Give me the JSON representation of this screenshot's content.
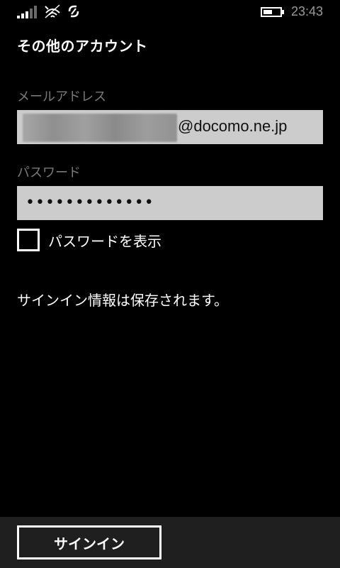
{
  "status_bar": {
    "time": "23:43",
    "icons": [
      "signal-icon",
      "wifi-icon",
      "sync-icon",
      "battery-icon"
    ],
    "battery_level": 0.5
  },
  "page": {
    "title": "その他のアカウント"
  },
  "form": {
    "email_label": "メールアドレス",
    "email_domain": "@docomo.ne.jp",
    "password_label": "パスワード",
    "password_value": "•••••••••••••",
    "show_password_label": "パスワードを表示",
    "show_password_checked": false,
    "info_text": "サインイン情報は保存されます。"
  },
  "app_bar": {
    "signin_label": "サインイン"
  },
  "colors": {
    "background": "#000000",
    "field_background": "#cccccc",
    "label_gray": "#7a7a7a",
    "app_bar": "#1f1f1f"
  }
}
